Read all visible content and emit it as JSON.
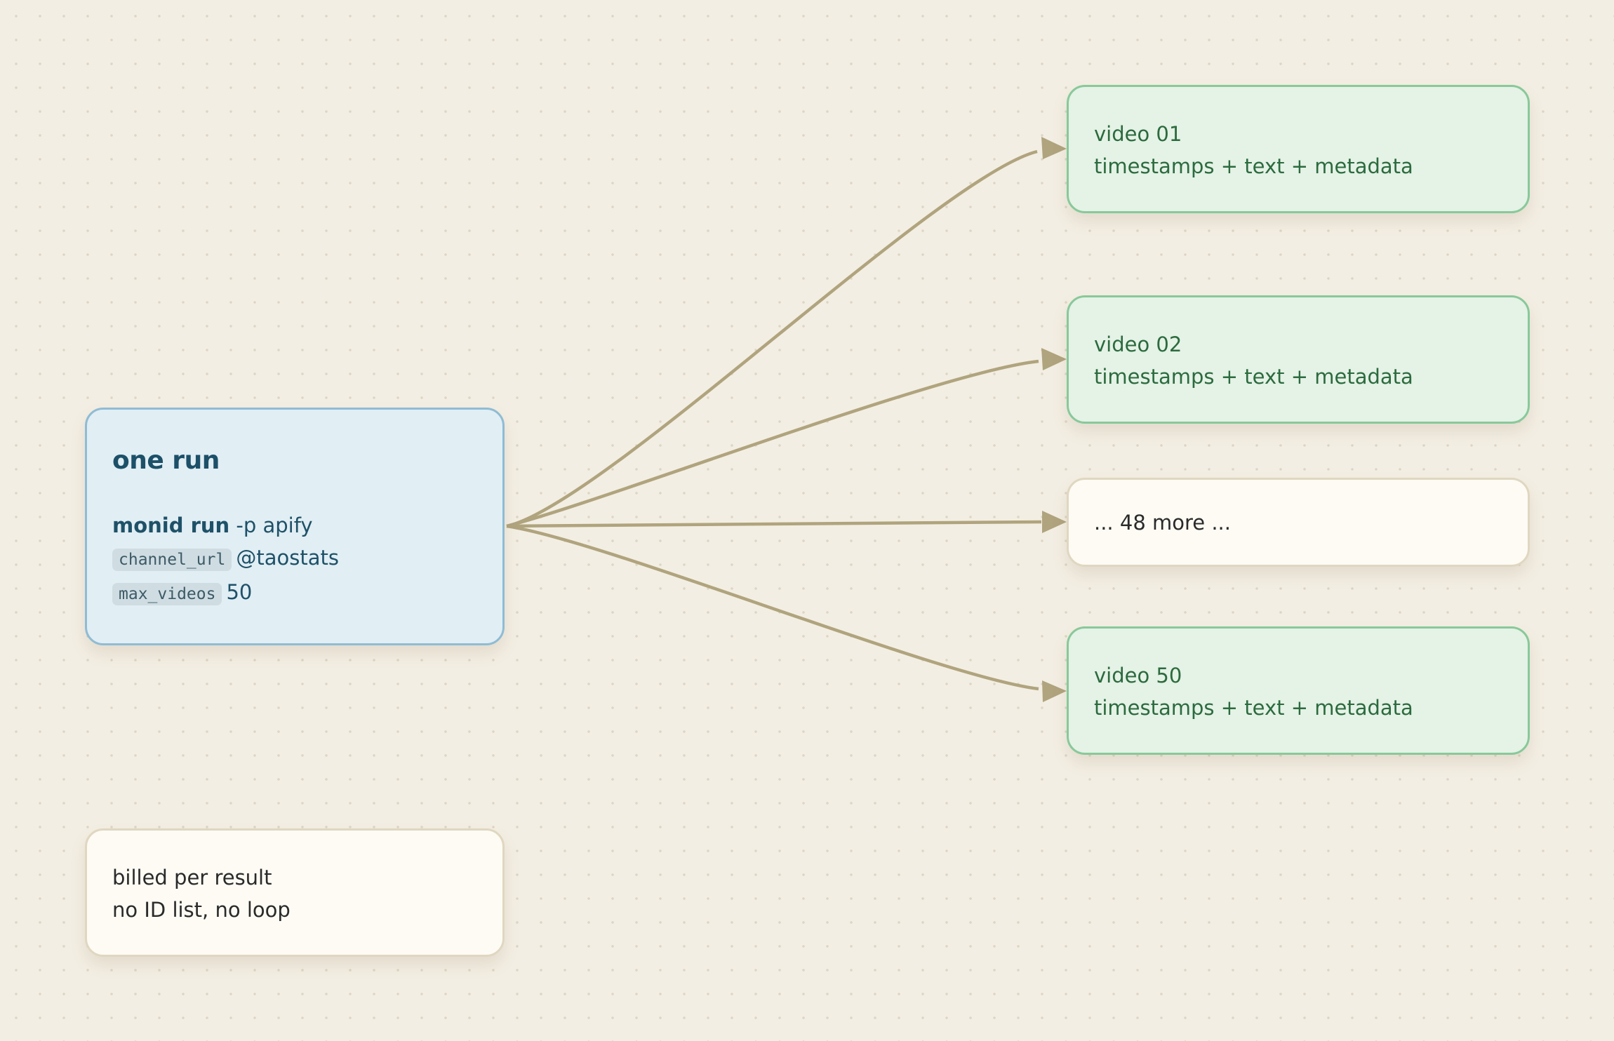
{
  "source_node": {
    "title": "one run",
    "command_bold": "monid run",
    "command_rest": " -p apify",
    "params": [
      {
        "key": "channel_url",
        "value": "@taostats"
      },
      {
        "key": "max_videos",
        "value": "50"
      }
    ]
  },
  "outputs": [
    {
      "id": "video-01",
      "title": "video 01",
      "detail": "timestamps + text + metadata"
    },
    {
      "id": "video-02",
      "title": "video 02",
      "detail": "timestamps + text + metadata"
    },
    {
      "id": "more",
      "label": "... 48 more ..."
    },
    {
      "id": "video-50",
      "title": "video 50",
      "detail": "timestamps + text + metadata"
    }
  ],
  "note": {
    "line1": "billed per result",
    "line2": "no ID list, no loop"
  },
  "edges": [
    {
      "from": "one run",
      "to": "video 01"
    },
    {
      "from": "one run",
      "to": "video 02"
    },
    {
      "from": "one run",
      "to": "... 48 more ..."
    },
    {
      "from": "one run",
      "to": "video 50"
    }
  ],
  "colors": {
    "background": "#f3eee3",
    "edge": "#b0a47e",
    "source_fill": "#e1eef4",
    "source_border": "#8fbcd4",
    "output_fill": "#e5f2e6",
    "output_border": "#88c99a",
    "neutral_fill": "#fdfbf4",
    "neutral_border": "#e0d7c1"
  }
}
